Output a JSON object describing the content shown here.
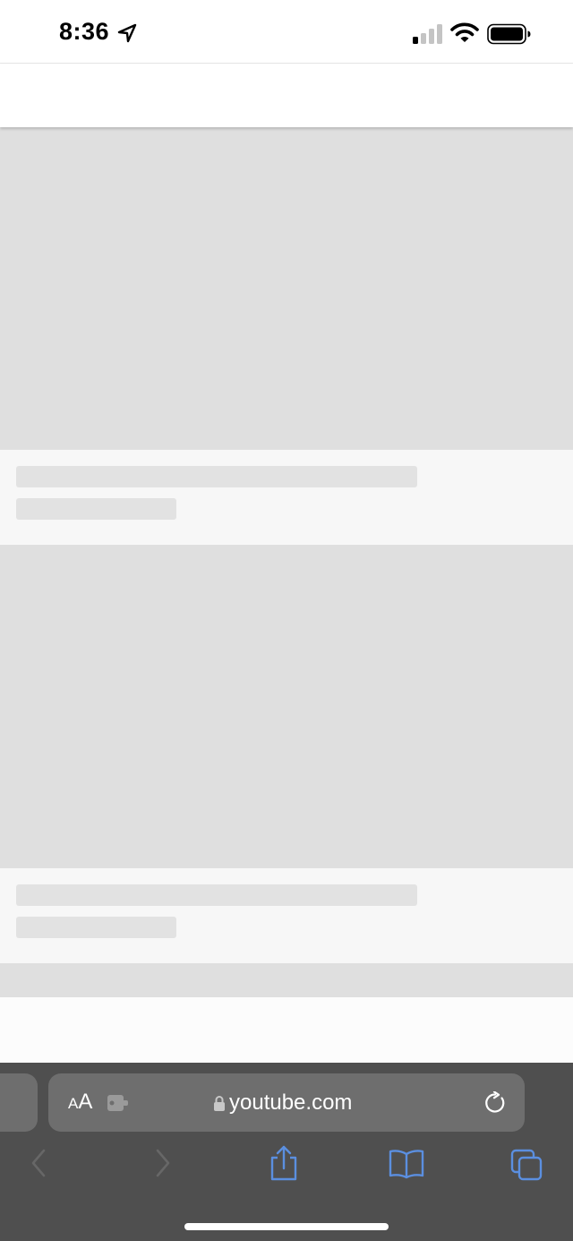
{
  "status_bar": {
    "time": "8:36",
    "icons": [
      "location-arrow-icon",
      "cellular-signal-icon",
      "wifi-icon",
      "battery-icon"
    ]
  },
  "feed": {
    "placeholder_colors": {
      "thumbnail": "#dfdfdf",
      "meta_background": "#f7f7f7",
      "text_bar": "#e2e2e2"
    }
  },
  "browser": {
    "text_size_label": {
      "small": "A",
      "large": "A"
    },
    "url": "youtube.com",
    "icons": [
      "extension-icon",
      "lock-icon",
      "reload-icon",
      "back-icon",
      "forward-icon",
      "share-icon",
      "bookmarks-icon",
      "tabs-icon"
    ],
    "colors": {
      "toolbar": "#4f4f4f",
      "address_bar": "#6e6e6e",
      "accent": "#5b8fe0",
      "disabled": "#676767"
    }
  }
}
